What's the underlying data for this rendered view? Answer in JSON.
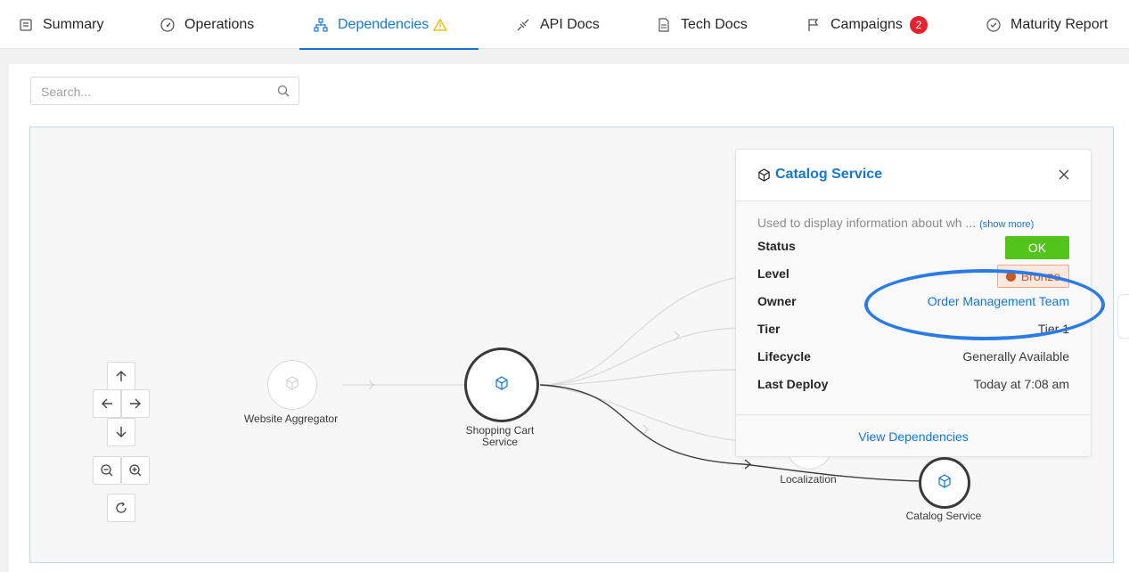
{
  "tabs": [
    {
      "label": "Summary",
      "icon": "summary-icon"
    },
    {
      "label": "Operations",
      "icon": "gauge-icon"
    },
    {
      "label": "Dependencies",
      "icon": "hierarchy-icon",
      "active": true,
      "warning": true
    },
    {
      "label": "API Docs",
      "icon": "plug-icon"
    },
    {
      "label": "Tech Docs",
      "icon": "document-icon"
    },
    {
      "label": "Campaigns",
      "icon": "flag-icon",
      "badge": "2"
    },
    {
      "label": "Maturity Report",
      "icon": "check-circle-icon"
    }
  ],
  "search": {
    "placeholder": "Search..."
  },
  "graph": {
    "nodes": [
      {
        "label": "Website Aggregator"
      },
      {
        "label_line1": "Shopping Cart",
        "label_line2": "Service"
      },
      {
        "label": "Localization"
      },
      {
        "label": "Catalog Service"
      }
    ]
  },
  "card": {
    "title": "Catalog Service",
    "description": "Used to display information about wh ...",
    "show_more": "(show more)",
    "rows": {
      "status_label": "Status",
      "status_value": "OK",
      "level_label": "Level",
      "level_value": "Bronze",
      "owner_label": "Owner",
      "owner_value": "Order Management Team",
      "tier_label": "Tier",
      "tier_value": "Tier 1",
      "lifecycle_label": "Lifecycle",
      "lifecycle_value": "Generally Available",
      "deploy_label": "Last Deploy",
      "deploy_value": "Today at 7:08 am"
    },
    "footer_link": "View Dependencies"
  },
  "colors": {
    "accent": "#1677d2",
    "ok": "#52c41a",
    "bronze": "#d4542a",
    "badge": "#e5222d",
    "highlight": "#2a7be4"
  }
}
